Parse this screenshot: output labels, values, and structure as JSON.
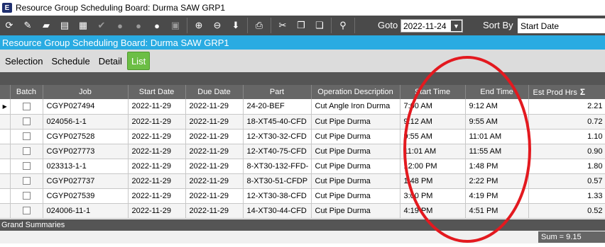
{
  "window": {
    "title": "Resource Group Scheduling Board: Durma SAW GRP1",
    "app_icon": "E"
  },
  "toolbar": {
    "icons": [
      "refresh-icon",
      "clear-icon",
      "folder-icon",
      "clipboard-icon",
      "calendar-icon",
      "check-icon",
      "person-icon",
      "person-check-icon",
      "person-group-icon",
      "resource-icon",
      "zoom-in-icon",
      "zoom-out-icon",
      "arrow-down-icon",
      "print-icon",
      "cut-icon",
      "copy-icon",
      "paste-icon",
      "binoculars-icon"
    ],
    "goto_label": "Goto",
    "goto_value": "2022-11-24",
    "sortby_label": "Sort By",
    "sortby_value": "Start Date"
  },
  "banner": {
    "title": "Resource Group Scheduling Board: Durma SAW GRP1"
  },
  "tabs": [
    {
      "label": "Selection",
      "active": false
    },
    {
      "label": "Schedule",
      "active": false
    },
    {
      "label": "Detail",
      "active": false
    },
    {
      "label": "List",
      "active": true
    }
  ],
  "grid": {
    "columns": [
      "Batch",
      "Job",
      "Start Date",
      "Due Date",
      "Part",
      "Operation Description",
      "Start Time",
      "End Time",
      "Est Prod Hrs"
    ],
    "rows": [
      {
        "job": "CGYP027494",
        "start_date": "2022-11-29",
        "due_date": "2022-11-29",
        "part": "24-20-BEF",
        "operation": "Cut Angle Iron Durma",
        "start_time": "7:00 AM",
        "end_time": "9:12 AM",
        "est_prod_hrs": "2.21"
      },
      {
        "job": "024056-1-1",
        "start_date": "2022-11-29",
        "due_date": "2022-11-29",
        "part": "18-XT45-40-CFD",
        "operation": "Cut Pipe Durma",
        "start_time": "9:12 AM",
        "end_time": "9:55 AM",
        "est_prod_hrs": "0.72"
      },
      {
        "job": "CGYP027528",
        "start_date": "2022-11-29",
        "due_date": "2022-11-29",
        "part": "12-XT30-32-CFD",
        "operation": "Cut Pipe Durma",
        "start_time": "9:55 AM",
        "end_time": "11:01 AM",
        "est_prod_hrs": "1.10"
      },
      {
        "job": "CGYP027773",
        "start_date": "2022-11-29",
        "due_date": "2022-11-29",
        "part": "12-XT40-75-CFD",
        "operation": "Cut Pipe Durma",
        "start_time": "11:01 AM",
        "end_time": "11:55 AM",
        "est_prod_hrs": "0.90"
      },
      {
        "job": "023313-1-1",
        "start_date": "2022-11-29",
        "due_date": "2022-11-29",
        "part": "8-XT30-132-FFD-",
        "operation": "Cut Pipe Durma",
        "start_time": "12:00 PM",
        "end_time": "1:48 PM",
        "est_prod_hrs": "1.80"
      },
      {
        "job": "CGYP027737",
        "start_date": "2022-11-29",
        "due_date": "2022-11-29",
        "part": "8-XT30-51-CFDP",
        "operation": "Cut Pipe Durma",
        "start_time": "1:48 PM",
        "end_time": "2:22 PM",
        "est_prod_hrs": "0.57"
      },
      {
        "job": "CGYP027539",
        "start_date": "2022-11-29",
        "due_date": "2022-11-29",
        "part": "12-XT30-38-CFD",
        "operation": "Cut Pipe Durma",
        "start_time": "3:00 PM",
        "end_time": "4:19 PM",
        "est_prod_hrs": "1.33"
      },
      {
        "job": "024006-11-1",
        "start_date": "2022-11-29",
        "due_date": "2022-11-29",
        "part": "14-XT30-44-CFD",
        "operation": "Cut Pipe Durma",
        "start_time": "4:19 PM",
        "end_time": "4:51 PM",
        "est_prod_hrs": "0.52"
      }
    ]
  },
  "summary": {
    "label": "Grand Summaries",
    "sum": "Sum = 9.15"
  },
  "annotation": {
    "color": "#e3191f"
  }
}
